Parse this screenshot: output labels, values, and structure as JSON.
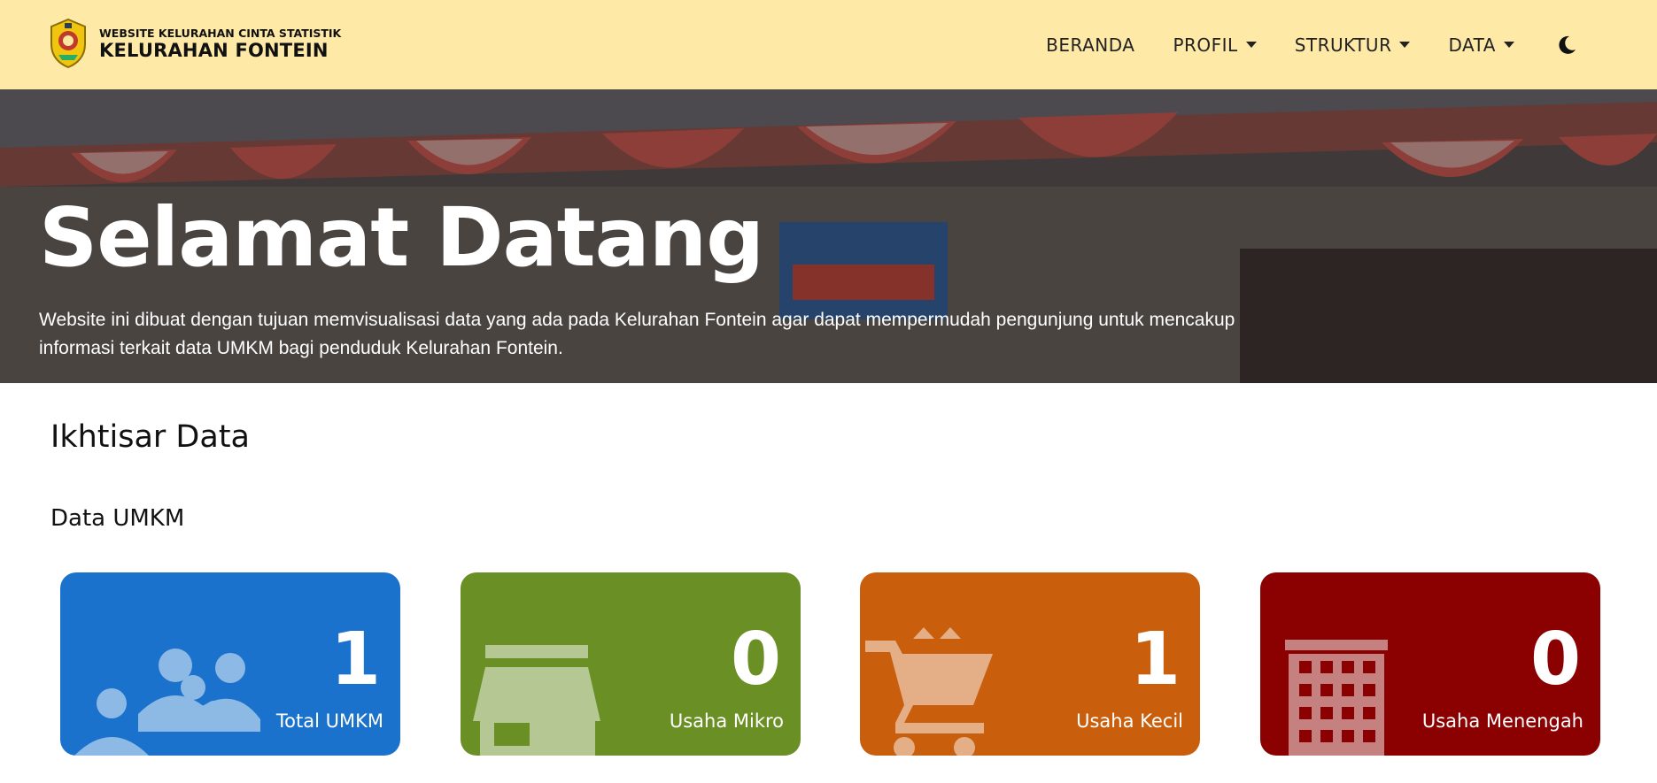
{
  "brand": {
    "subtitle": "WEBSITE KELURAHAN CINTA STATISTIK",
    "title": "KELURAHAN FONTEIN"
  },
  "nav": {
    "items": [
      {
        "label": "BERANDA",
        "dropdown": false
      },
      {
        "label": "PROFIL",
        "dropdown": true
      },
      {
        "label": "STRUKTUR",
        "dropdown": true
      },
      {
        "label": "DATA",
        "dropdown": true
      }
    ],
    "theme_toggle_icon": "moon-icon"
  },
  "hero": {
    "title": "Selamat Datang",
    "description": "Website ini dibuat dengan tujuan memvisualisasi data yang ada pada Kelurahan Fontein agar dapat mempermudah pengunjung untuk mencakup informasi terkait data UMKM bagi penduduk Kelurahan Fontein."
  },
  "overview": {
    "title": "Ikhtisar Data",
    "subtitle": "Data UMKM",
    "cards": [
      {
        "value": "1",
        "label": "Total UMKM",
        "icon": "people-icon",
        "color": "#1b72cc"
      },
      {
        "value": "0",
        "label": "Usaha Mikro",
        "icon": "store-icon",
        "color": "#6a8f24"
      },
      {
        "value": "1",
        "label": "Usaha Kecil",
        "icon": "cart-icon",
        "color": "#c95f0d"
      },
      {
        "value": "0",
        "label": "Usaha Menengah",
        "icon": "building-icon",
        "color": "#8b0000"
      }
    ]
  }
}
